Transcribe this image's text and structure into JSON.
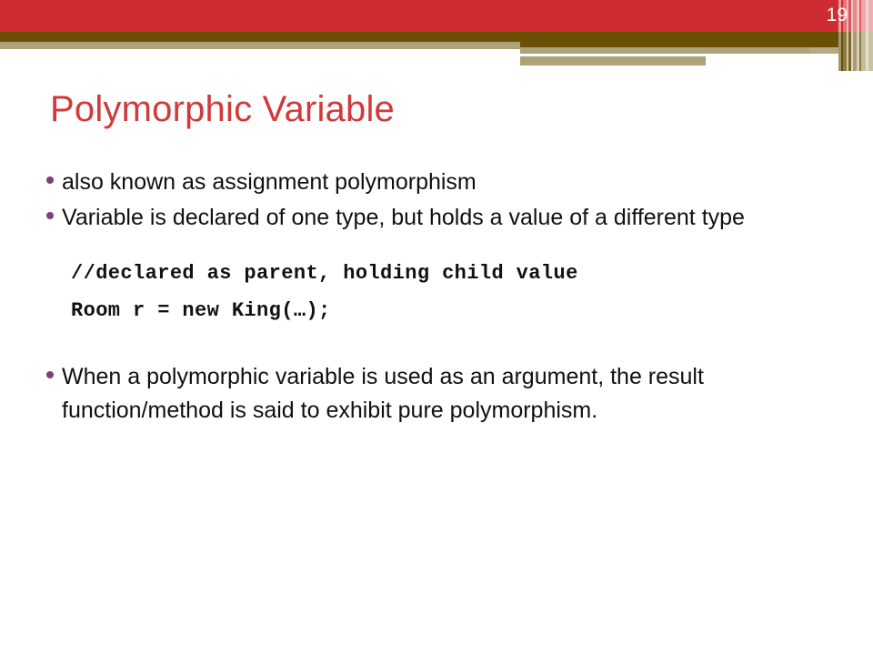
{
  "slide": {
    "page_number": "19",
    "title": "Polymorphic Variable",
    "colors": {
      "header_red": "#cf2c31",
      "title_red": "#d03a3c",
      "olive": "#6b4f05",
      "tan": "#aea27b",
      "bullet_purple": "#7b3f7d",
      "body_text": "#101010"
    },
    "bullets": [
      {
        "text": "also known as assignment polymorphism"
      },
      {
        "text": "Variable is declared of one type, but holds a value of a different type"
      },
      {
        "text": "When a polymorphic variable is used as an argument, the result function/method is said to exhibit pure polymorphism."
      }
    ],
    "code": {
      "lines": [
        "//declared as parent, holding child value",
        "Room r = new King(…);"
      ]
    }
  }
}
